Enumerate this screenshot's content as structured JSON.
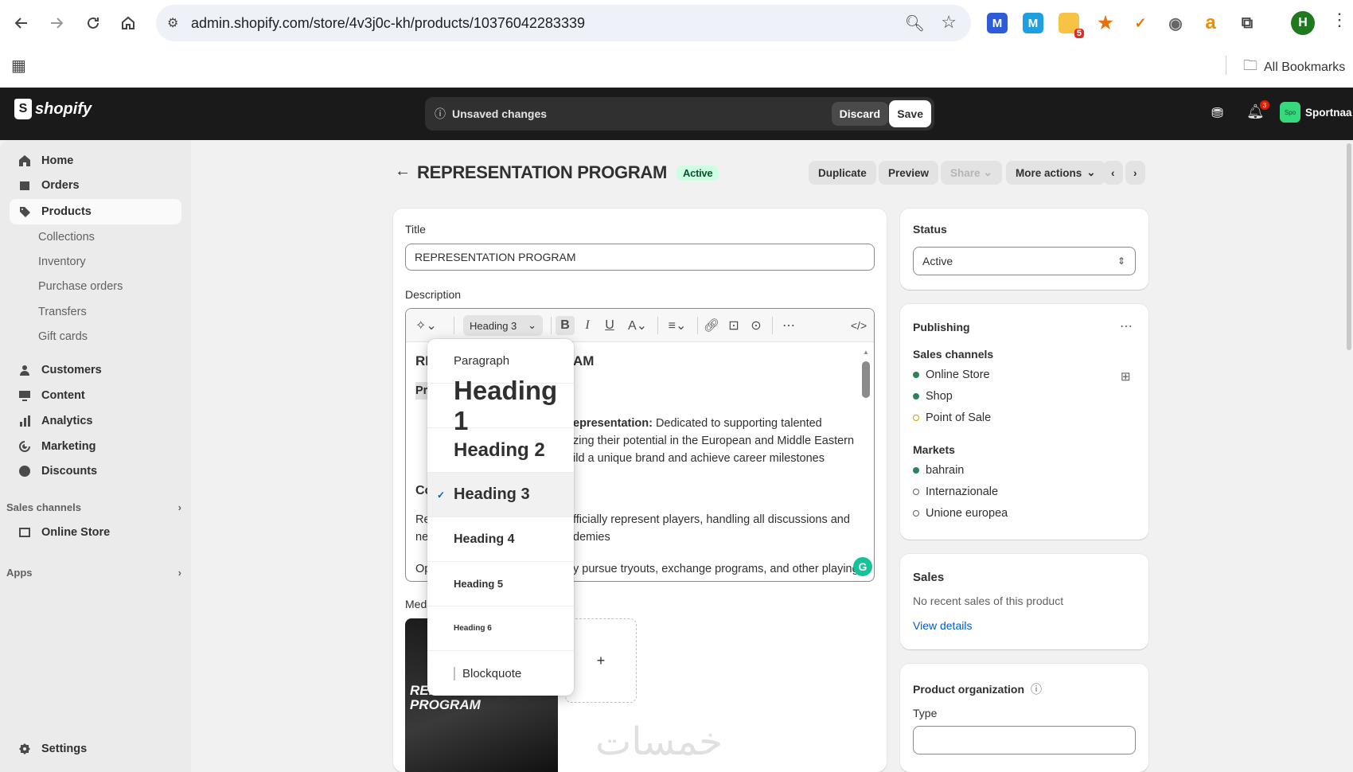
{
  "browser": {
    "url": "admin.shopify.com/store/4v3j0c-kh/products/10376042283339",
    "bookmarks_label": "All Bookmarks",
    "profile_initial": "H",
    "extensions_badge": "5"
  },
  "topbar": {
    "logo_text": "shopify",
    "unsaved_label": "Unsaved changes",
    "discard_label": "Discard",
    "save_label": "Save",
    "store_name": "Sportnaa",
    "store_avatar_text": "Spo",
    "notification_count": "3"
  },
  "sidebar": {
    "items": [
      {
        "label": "Home",
        "icon": "home-icon"
      },
      {
        "label": "Orders",
        "icon": "orders-icon"
      },
      {
        "label": "Products",
        "icon": "tag-icon"
      },
      {
        "label": "Customers",
        "icon": "person-icon"
      },
      {
        "label": "Content",
        "icon": "content-icon"
      },
      {
        "label": "Analytics",
        "icon": "chart-icon"
      },
      {
        "label": "Marketing",
        "icon": "target-icon"
      },
      {
        "label": "Discounts",
        "icon": "discount-icon"
      }
    ],
    "products_sub": [
      "Collections",
      "Inventory",
      "Purchase orders",
      "Transfers",
      "Gift cards"
    ],
    "sales_channels_label": "Sales channels",
    "online_store_label": "Online Store",
    "apps_label": "Apps",
    "settings_label": "Settings"
  },
  "header": {
    "title": "REPRESENTATION PROGRAM",
    "status_badge": "Active",
    "duplicate_label": "Duplicate",
    "preview_label": "Preview",
    "share_label": "Share",
    "more_actions_label": "More actions"
  },
  "product": {
    "title_label": "Title",
    "title_value": "REPRESENTATION PROGRAM",
    "description_label": "Description",
    "media_label": "Medi",
    "editor": {
      "heading_select": "Heading 3",
      "line1_start": "RE",
      "line1_end": "AM",
      "line2_start": "Pr",
      "para1_bold": "epresentation:",
      "para1_rest": " Dedicated to supporting talented",
      "para1_l2": "zing their potential in the European and Middle Eastern",
      "para1_l3": "ild a unique brand and achieve career milestones",
      "line_c": "Co",
      "line_re": "Re",
      "line_ne": "ne",
      "para2_l1": "fficially represent players, handling all discussions and",
      "para2_l2": "demies",
      "line_op": "Op",
      "para3": "y pursue tryouts, exchange programs, and other playing"
    },
    "media_image_text": "REPRESENTATION PROGRAM",
    "add_media": "+"
  },
  "dropdown": {
    "items": [
      {
        "label": "Paragraph"
      },
      {
        "label": "Heading 1"
      },
      {
        "label": "Heading 2"
      },
      {
        "label": "Heading 3",
        "selected": true
      },
      {
        "label": "Heading 4"
      },
      {
        "label": "Heading 5"
      },
      {
        "label": "Heading 6"
      },
      {
        "label": "Blockquote"
      }
    ],
    "check": "✓"
  },
  "status_card": {
    "label": "Status",
    "value": "Active"
  },
  "publishing": {
    "title": "Publishing",
    "sales_channels_label": "Sales channels",
    "channels": [
      {
        "name": "Online Store",
        "state": "on"
      },
      {
        "name": "Shop",
        "state": "on"
      },
      {
        "name": "Point of Sale",
        "state": "pending"
      }
    ],
    "markets_label": "Markets",
    "markets": [
      {
        "name": "bahrain",
        "state": "on"
      },
      {
        "name": "Internazionale",
        "state": "off"
      },
      {
        "name": "Unione europea",
        "state": "off"
      }
    ]
  },
  "sales_card": {
    "title": "Sales",
    "text": "No recent sales of this product",
    "link": "View details"
  },
  "organization": {
    "title": "Product organization",
    "type_label": "Type"
  },
  "watermark": "خمسات",
  "colors": {
    "accent": "#005bd3",
    "active_badge_bg": "#cdfee1",
    "dot_on": "#29845a",
    "dot_pending": "#c9a000",
    "topbar_bg": "#1a1a1a"
  }
}
